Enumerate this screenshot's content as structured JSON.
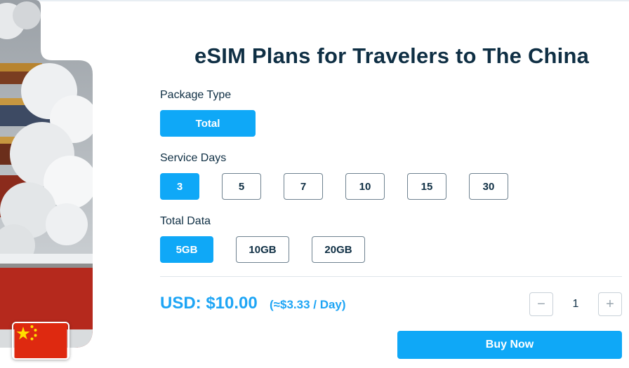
{
  "title": "eSIM Plans for Travelers to The China",
  "package_type": {
    "label": "Package Type",
    "options": [
      "Total"
    ],
    "selected": "Total"
  },
  "service_days": {
    "label": "Service Days",
    "options": [
      "3",
      "5",
      "7",
      "10",
      "15",
      "30"
    ],
    "selected": "3"
  },
  "total_data": {
    "label": "Total Data",
    "options": [
      "5GB",
      "10GB",
      "20GB"
    ],
    "selected": "5GB"
  },
  "price": {
    "text": "USD: $10.00",
    "per_day": "(≈$3.33 / Day)"
  },
  "quantity": {
    "value": "1",
    "minus": "−",
    "plus": "+"
  },
  "buy_label": "Buy Now",
  "colors": {
    "accent": "#0fa8f7",
    "price": "#1ea5f5",
    "text": "#0f2f44"
  },
  "icons": {
    "flag": "china-flag-icon",
    "hero": "forbidden-city-snow-image"
  }
}
